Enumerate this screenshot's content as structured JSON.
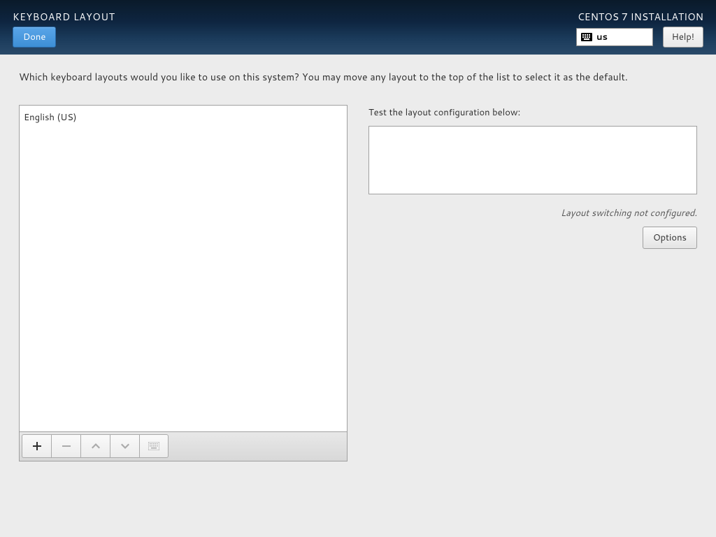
{
  "header": {
    "title": "KEYBOARD LAYOUT",
    "installer_title": "CENTOS 7 INSTALLATION",
    "done_label": "Done",
    "help_label": "Help!",
    "lang_indicator": "us"
  },
  "main": {
    "instruction": "Which keyboard layouts would you like to use on this system?  You may move any layout to the top of the list to select it as the default.",
    "layouts": [
      "English (US)"
    ],
    "test_label": "Test the layout configuration below:",
    "test_value": "",
    "switch_status": "Layout switching not configured.",
    "options_label": "Options"
  }
}
